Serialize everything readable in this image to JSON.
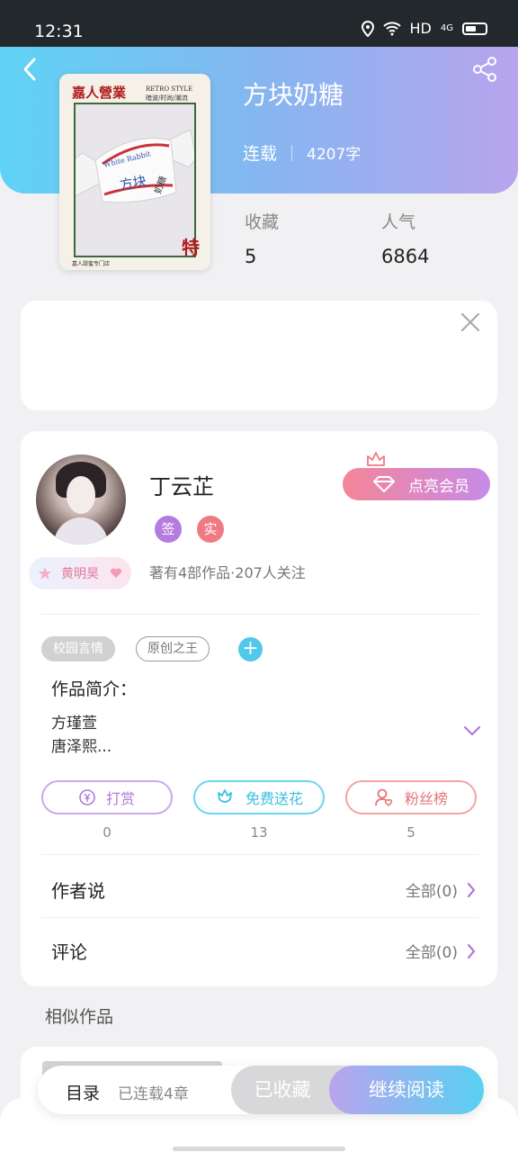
{
  "status_bar": {
    "time": "12:31",
    "network": "HD",
    "signal": "4G"
  },
  "book": {
    "title": "方块奶糖",
    "status": "连载",
    "word_count": "4207字",
    "stats": [
      {
        "label": "收藏",
        "value": "5"
      },
      {
        "label": "人气",
        "value": "6864"
      }
    ],
    "cover": {
      "title": "嘉人營業",
      "subtitle_1": "RETRO STYLE",
      "subtitle_2": "暗波/时尚/潮流",
      "text_1": "White Rabbit",
      "text_2": "方块",
      "text_3": "奶糖",
      "corner_char": "特",
      "footer": "嘉人甜蜜专门店"
    }
  },
  "author": {
    "name": "丁云芷",
    "frame_name": "黄明昊",
    "badge_sign": "签",
    "badge_real": "实",
    "info": "著有4部作品·207人关注",
    "vip_label": "点亮会员"
  },
  "tags": [
    "校园言情",
    "原创之王"
  ],
  "intro": {
    "label": "作品简介：",
    "line1": "方瑾萱",
    "line2": "唐泽熙..."
  },
  "actions": [
    {
      "label": "打赏",
      "count": "0"
    },
    {
      "label": "免费送花",
      "count": "13"
    },
    {
      "label": "粉丝榜",
      "count": "5"
    }
  ],
  "author_says": {
    "label": "作者说",
    "link": "全部(0)"
  },
  "comments": {
    "label": "评论",
    "link": "全部(0)"
  },
  "similar": {
    "title": "相似作品"
  },
  "bottom_bar": {
    "toc": "目录",
    "toc_status": "已连载4章",
    "favorite": "已收藏",
    "read": "继续阅读"
  },
  "colors": {
    "accent_blue": "#4fc8ec",
    "accent_purple": "#b47be0",
    "accent_pink": "#f07a84"
  }
}
